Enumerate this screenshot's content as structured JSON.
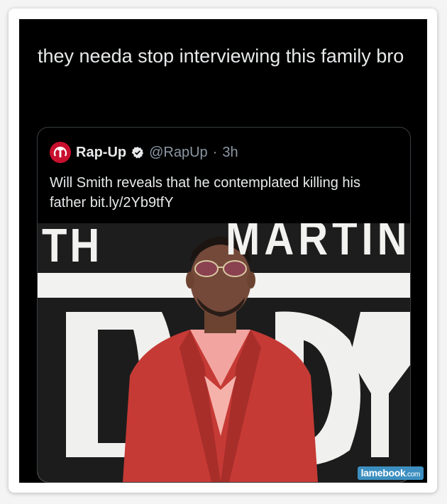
{
  "tweet": {
    "text": "they needa stop interviewing this family bro"
  },
  "quoted_tweet": {
    "name": "Rap-Up",
    "handle": "@RapUp",
    "separator": "·",
    "time": "3h",
    "text": "Will Smith reveals that he contemplated killing his father bit.ly/2Yb9tfY",
    "avatar_color": "#c8102e",
    "verified_icon": "verified-badge-icon",
    "photo": {
      "backdrop_text_left": "TH",
      "backdrop_text_right": "MARTIN LA"
    }
  },
  "watermark": {
    "main": "lamebook",
    "suffix": ".com"
  },
  "colors": {
    "background": "#000000",
    "text": "#e7e9ea",
    "muted": "#8b98a5",
    "border": "#3a3f44"
  }
}
